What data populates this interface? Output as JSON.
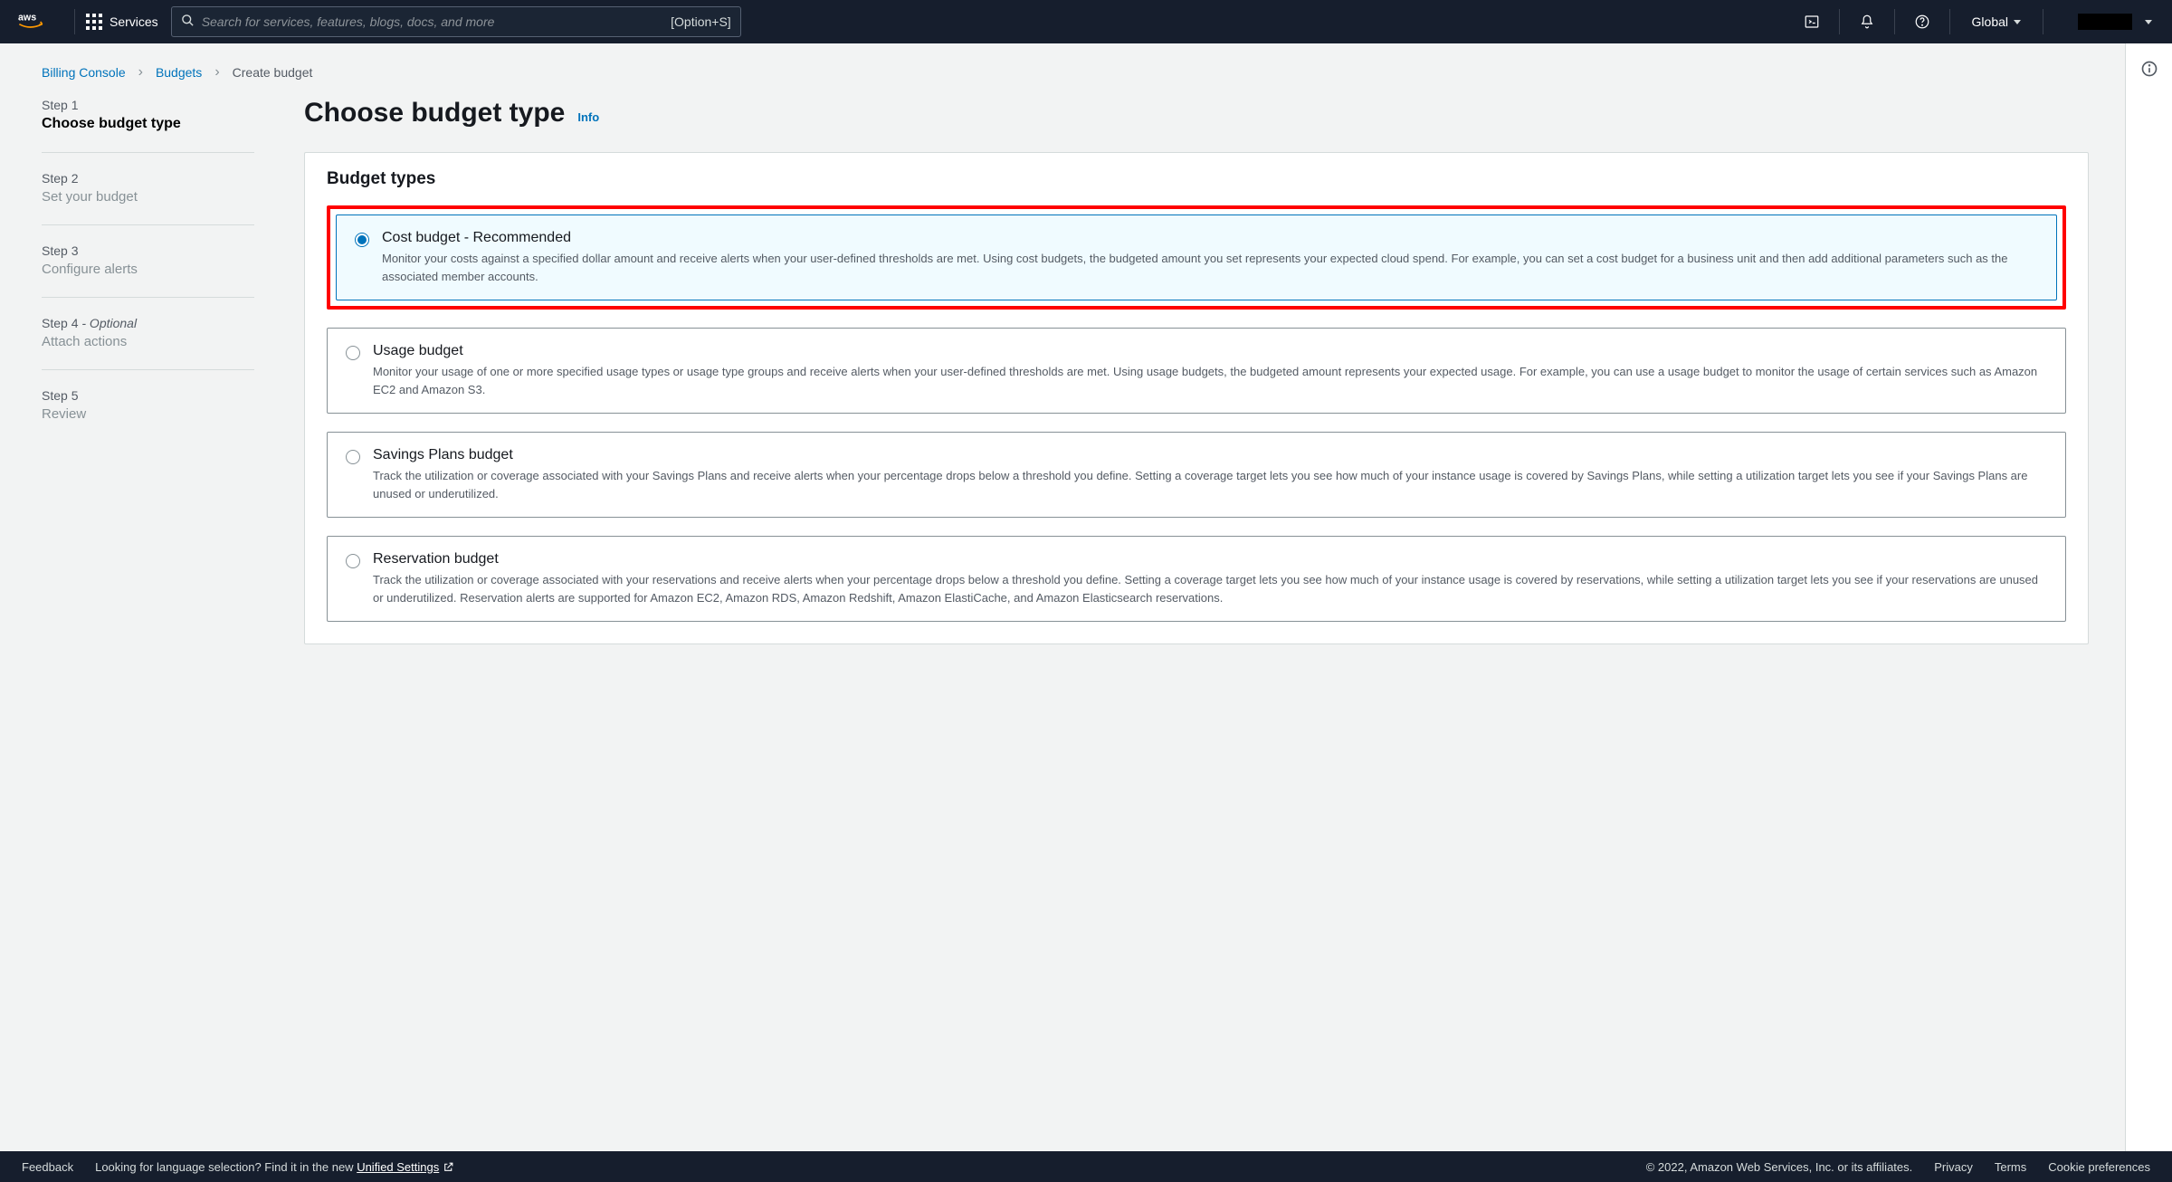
{
  "nav": {
    "services_label": "Services",
    "search_placeholder": "Search for services, features, blogs, docs, and more",
    "search_shortcut": "[Option+S]",
    "region": "Global"
  },
  "breadcrumb": {
    "items": [
      "Billing Console",
      "Budgets"
    ],
    "current": "Create budget"
  },
  "stepper": {
    "steps": [
      {
        "label": "Step 1",
        "title": "Choose budget type",
        "current": true
      },
      {
        "label": "Step 2",
        "title": "Set your budget"
      },
      {
        "label": "Step 3",
        "title": "Configure alerts"
      },
      {
        "label": "Step 4",
        "optional": "- Optional",
        "title": "Attach actions"
      },
      {
        "label": "Step 5",
        "title": "Review"
      }
    ]
  },
  "page": {
    "title": "Choose budget type",
    "info_link": "Info",
    "panel_title": "Budget types"
  },
  "options": [
    {
      "title": "Cost budget - Recommended",
      "desc": "Monitor your costs against a specified dollar amount and receive alerts when your user-defined thresholds are met. Using cost budgets, the budgeted amount you set represents your expected cloud spend. For example, you can set a cost budget for a business unit and then add additional parameters such as the associated member accounts.",
      "selected": true,
      "highlighted": true
    },
    {
      "title": "Usage budget",
      "desc": "Monitor your usage of one or more specified usage types or usage type groups and receive alerts when your user-defined thresholds are met. Using usage budgets, the budgeted amount represents your expected usage. For example, you can use a usage budget to monitor the usage of certain services such as Amazon EC2 and Amazon S3."
    },
    {
      "title": "Savings Plans budget",
      "desc": "Track the utilization or coverage associated with your Savings Plans and receive alerts when your percentage drops below a threshold you define. Setting a coverage target lets you see how much of your instance usage is covered by Savings Plans, while setting a utilization target lets you see if your Savings Plans are unused or underutilized."
    },
    {
      "title": "Reservation budget",
      "desc": "Track the utilization or coverage associated with your reservations and receive alerts when your percentage drops below a threshold you define. Setting a coverage target lets you see how much of your instance usage is covered by reservations, while setting a utilization target lets you see if your reservations are unused or underutilized. Reservation alerts are supported for Amazon EC2, Amazon RDS, Amazon Redshift, Amazon ElastiCache, and Amazon Elasticsearch reservations."
    }
  ],
  "footer": {
    "feedback": "Feedback",
    "lang_text": "Looking for language selection? Find it in the new ",
    "lang_link": "Unified Settings",
    "copyright": "© 2022, Amazon Web Services, Inc. or its affiliates.",
    "links": [
      "Privacy",
      "Terms",
      "Cookie preferences"
    ]
  }
}
